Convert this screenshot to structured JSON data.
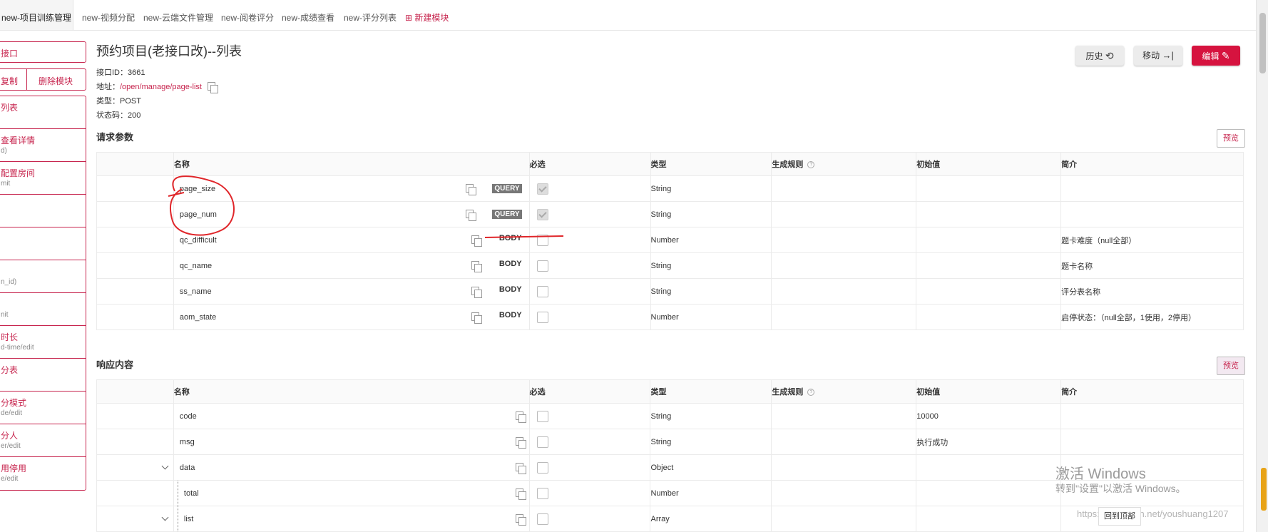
{
  "tabs": [
    {
      "label": "new-项目训练管理"
    },
    {
      "label": "new-视频分配"
    },
    {
      "label": "new-云端文件管理"
    },
    {
      "label": "new-阅卷评分"
    },
    {
      "label": "new-成绩查看"
    },
    {
      "label": "new-评分列表"
    },
    {
      "label": "新建模块"
    }
  ],
  "sidebar": {
    "top_button": "接口",
    "copy_button": "复制",
    "delete_button": "删除模块",
    "items": [
      {
        "title": "列表",
        "sub": ""
      },
      {
        "title": "查看详情",
        "sub": "d)"
      },
      {
        "title": "配置房间",
        "sub": "mit"
      },
      {
        "title": "",
        "sub": ""
      },
      {
        "title": "",
        "sub": ""
      },
      {
        "title": "",
        "sub": "n_id)"
      },
      {
        "title": "",
        "sub": "nit"
      },
      {
        "title": "时长",
        "sub": "d-time/edit"
      },
      {
        "title": "分表",
        "sub": ""
      },
      {
        "title": "分模式",
        "sub": "de/edit"
      },
      {
        "title": "分人",
        "sub": "er/edit"
      },
      {
        "title": "用停用",
        "sub": "e/edit"
      }
    ]
  },
  "page": {
    "title": "预约项目(老接口改)--列表",
    "id_label": "接口ID：",
    "id_value": "3661",
    "addr_label": "地址：",
    "addr_value": "/open/manage/page-list",
    "type_label": "类型：",
    "type_value": "POST",
    "status_label": "状态码：",
    "status_value": "200"
  },
  "actions": {
    "history": "历史",
    "move": "移动",
    "edit": "编辑"
  },
  "request": {
    "title": "请求参数",
    "preview": "预览",
    "headers": [
      "名称",
      "必选",
      "类型",
      "生成规则",
      "初始值",
      "简介"
    ],
    "rows": [
      {
        "name": "page_size",
        "loc": "QUERY",
        "required": true,
        "type": "String",
        "rule": "",
        "init": "",
        "desc": ""
      },
      {
        "name": "page_num",
        "loc": "QUERY",
        "required": true,
        "type": "String",
        "rule": "",
        "init": "",
        "desc": ""
      },
      {
        "name": "qc_difficult",
        "loc": "BODY",
        "required": false,
        "type": "Number",
        "rule": "",
        "init": "",
        "desc": "题卡难度（null全部）"
      },
      {
        "name": "qc_name",
        "loc": "BODY",
        "required": false,
        "type": "String",
        "rule": "",
        "init": "",
        "desc": "题卡名称"
      },
      {
        "name": "ss_name",
        "loc": "BODY",
        "required": false,
        "type": "String",
        "rule": "",
        "init": "",
        "desc": "评分表名称"
      },
      {
        "name": "aom_state",
        "loc": "BODY",
        "required": false,
        "type": "Number",
        "rule": "",
        "init": "",
        "desc": "启停状态：（null全部，1使用，2停用）"
      }
    ]
  },
  "response": {
    "title": "响应内容",
    "preview": "预览",
    "headers": [
      "名称",
      "必选",
      "类型",
      "生成规则",
      "初始值",
      "简介"
    ],
    "rows": [
      {
        "name": "code",
        "type": "String",
        "init": "10000",
        "expand": false,
        "child": false
      },
      {
        "name": "msg",
        "type": "String",
        "init": "执行成功",
        "expand": false,
        "child": false
      },
      {
        "name": "data",
        "type": "Object",
        "init": "",
        "expand": true,
        "child": false
      },
      {
        "name": "total",
        "type": "Number",
        "init": "",
        "expand": false,
        "child": true
      },
      {
        "name": "list",
        "type": "Array",
        "init": "",
        "expand": true,
        "child": true
      }
    ]
  },
  "overlay": {
    "activate_title": "激活 Windows",
    "activate_sub": "转到\"设置\"以激活 Windows。",
    "url_watermark": "https://blog.csdn.net/youshuang1207",
    "back_to_top": "回到顶部"
  }
}
